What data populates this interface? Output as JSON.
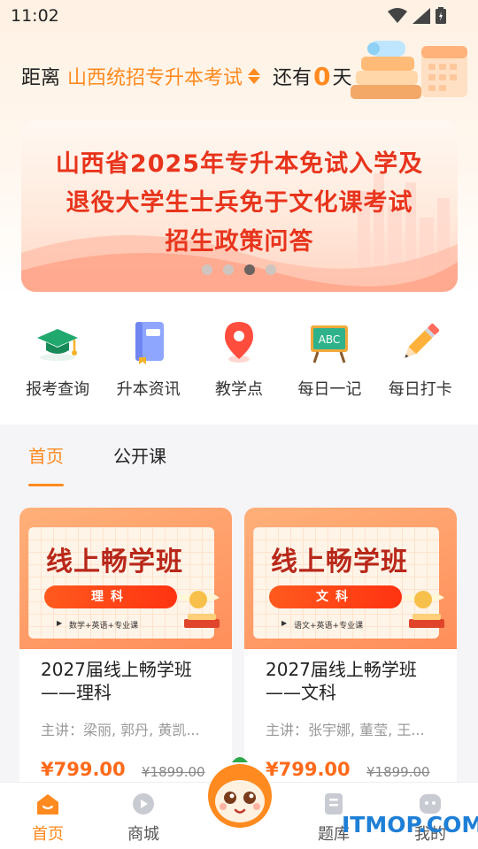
{
  "status": {
    "time": "11:02"
  },
  "countdown": {
    "prefix": "距离",
    "exam": "山西统招专升本考试",
    "middle": "还有",
    "days": "0",
    "suffix": "天"
  },
  "banner": {
    "line1": "山西省2025年专升本免试入学及",
    "line2": "退役大学生士兵免于文化课考试",
    "line3": "招生政策问答",
    "dots_total": 4,
    "dots_active_index": 3
  },
  "quick_menu": [
    {
      "label": "报考查询",
      "icon": "graduation-cap-icon"
    },
    {
      "label": "升本资讯",
      "icon": "book-icon"
    },
    {
      "label": "教学点",
      "icon": "location-pin-icon"
    },
    {
      "label": "每日一记",
      "icon": "abc-board-icon"
    },
    {
      "label": "每日打卡",
      "icon": "pencil-icon"
    }
  ],
  "tabs": [
    {
      "label": "首页",
      "active": true
    },
    {
      "label": "公开课",
      "active": false
    }
  ],
  "courses": [
    {
      "image_title": "线上畅学班",
      "image_badge": "理科",
      "image_sub": "数学+英语+专业课",
      "name": "2027届线上畅学班——理科",
      "teachers": "主讲：梁丽, 郭丹, 黄凯...",
      "price": "¥799.00",
      "original_price": "¥1899.00"
    },
    {
      "image_title": "线上畅学班",
      "image_badge": "文科",
      "image_sub": "语文+英语+专业课",
      "name": "2027届线上畅学班——文科",
      "teachers": "主讲：张宇娜, 董莹, 王...",
      "price": "¥799.00",
      "original_price": "¥1899.00"
    }
  ],
  "bottom_nav": [
    {
      "label": "首页",
      "icon": "home-icon",
      "active": true
    },
    {
      "label": "商城",
      "icon": "play-circle-icon",
      "active": false
    },
    {
      "label": "题库",
      "icon": "question-bank-icon",
      "active": false
    },
    {
      "label": "我的",
      "icon": "profile-icon",
      "active": false
    }
  ],
  "watermark": "ITMOP.COM",
  "colors": {
    "accent": "#ff8a1f",
    "banner_text": "#e8341c",
    "price": "#ff6a1a"
  }
}
